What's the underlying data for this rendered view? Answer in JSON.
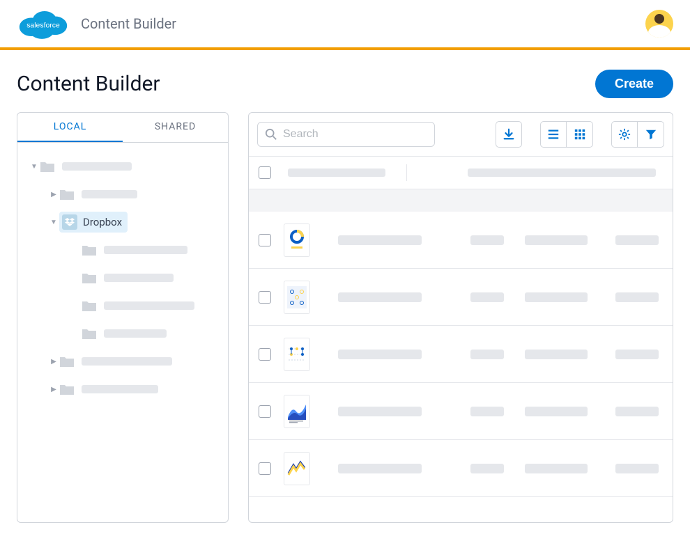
{
  "header": {
    "app_name": "Content Builder",
    "logo_text": "salesforce"
  },
  "page": {
    "title": "Content Builder",
    "create_label": "Create"
  },
  "sidebar": {
    "tabs": {
      "local": "LOCAL",
      "shared": "SHARED"
    },
    "active_tab": "local",
    "selected_folder": "Dropbox"
  },
  "toolbar": {
    "search_placeholder": "Search",
    "icons": {
      "download": "download-icon",
      "list_view": "list-view-icon",
      "grid_view": "grid-view-icon",
      "settings": "gear-icon",
      "filter": "filter-icon"
    }
  },
  "colors": {
    "accent": "#0176d3",
    "divider_orange": "#f29e02",
    "selected_bg": "#e0f0fb"
  }
}
